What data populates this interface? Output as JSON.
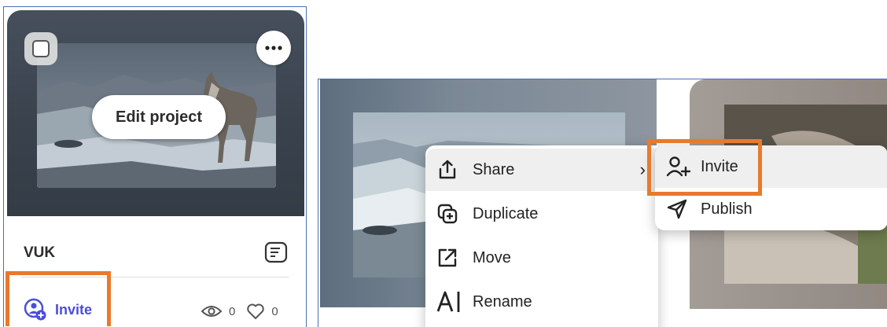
{
  "project_card": {
    "edit_button_label": "Edit project",
    "title": "VUK",
    "invite_label": "Invite",
    "views_count": "0",
    "likes_count": "0"
  },
  "context_menu": {
    "items": [
      {
        "label": "Share",
        "icon": "share-icon",
        "has_submenu": true
      },
      {
        "label": "Duplicate",
        "icon": "duplicate-icon"
      },
      {
        "label": "Move",
        "icon": "move-icon"
      },
      {
        "label": "Rename",
        "icon": "rename-icon"
      }
    ],
    "share_submenu": [
      {
        "label": "Invite",
        "icon": "add-user-icon"
      },
      {
        "label": "Publish",
        "icon": "send-icon"
      }
    ],
    "submenu_chevron": "›"
  },
  "colors": {
    "highlight": "#e8792d",
    "invite_accent": "#4b4fd6",
    "frame_border": "#4a6fb5"
  }
}
